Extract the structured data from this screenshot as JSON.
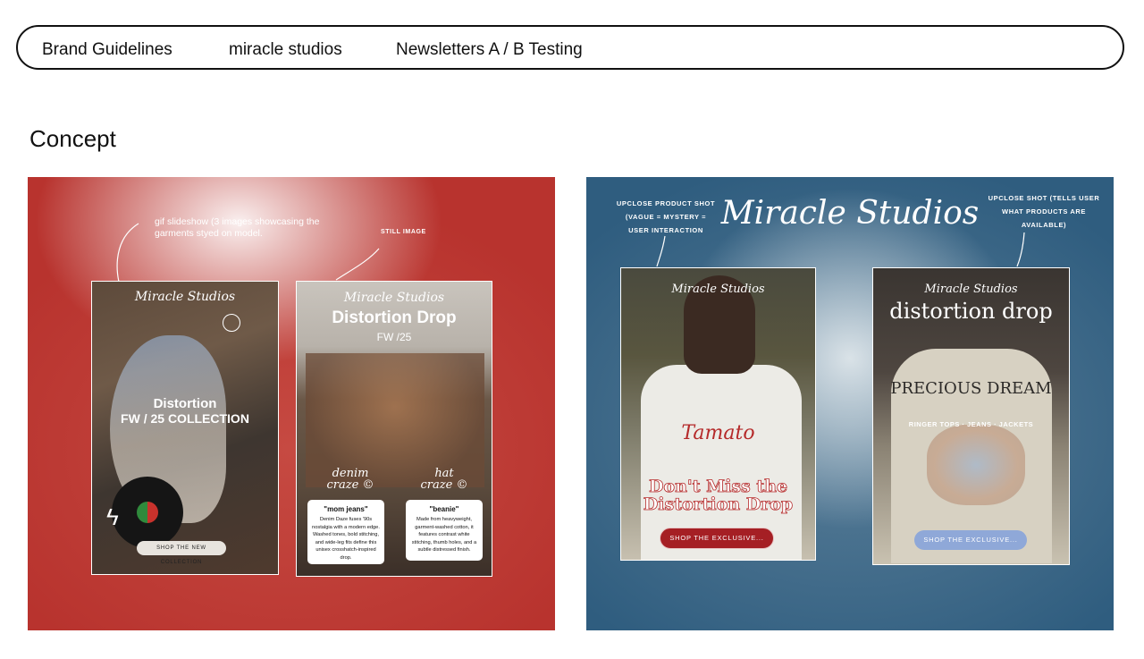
{
  "nav": {
    "items": [
      "Brand Guidelines",
      "miracle studios",
      "Newsletters A / B Testing"
    ]
  },
  "section": {
    "title": "Concept"
  },
  "red_panel": {
    "note_gif": "gif slideshow (3 images showcasing the garments styed on model.",
    "note_still": "STILL IMAGE",
    "phone1": {
      "brand": "Miracle Studios",
      "line1": "Distortion",
      "line2": "FW / 25 COLLECTION",
      "cta": "SHOP THE NEW COLLECTION"
    },
    "phone2": {
      "brand": "Miracle Studios",
      "headline": "Distortion Drop",
      "sub": "FW /25",
      "tag_left": "denim craze ©",
      "tag_right": "hat craze ©",
      "cards": [
        {
          "title": "\"mom jeans\"",
          "body": "Denim Daze fuses '90s nostalgia with a modern edge. Washed tones, bold stitching, and wide-leg fits define this unisex crosshatch-inspired drop."
        },
        {
          "title": "\"beanie\"",
          "body": "Made from heavyweight, garment-washed cotton, it features contrast white stitching, thumb holes, and a subtle distressed finish."
        }
      ]
    }
  },
  "blue_panel": {
    "brand": "Miracle Studios",
    "note_left": "UPCLOSE PRODUCT SHOT (VAGUE = MYSTERY = USER INTERACTION",
    "note_right": "UPCLOSE SHOT (TELLS USER WHAT PRODUCTS ARE AVAILABLE)",
    "phone1": {
      "brand": "Miracle Studios",
      "shirt_text": "Tamato",
      "headline": "Don't Miss the Distortion Drop",
      "cta": "SHOP THE EXCLUSIVE..."
    },
    "phone2": {
      "brand": "Miracle Studios",
      "headline": "distortion drop",
      "shirt_text": "PRECIOUS DREAM",
      "categories": "RINGER TOPS · JEANS · JACKETS",
      "cta": "SHOP THE EXCLUSIVE..."
    }
  },
  "colors": {
    "red_panel": "#b8332e",
    "blue_panel": "#2f5d7f",
    "cta_red": "#a51f24",
    "cta_blue": "#8fa8d8"
  }
}
